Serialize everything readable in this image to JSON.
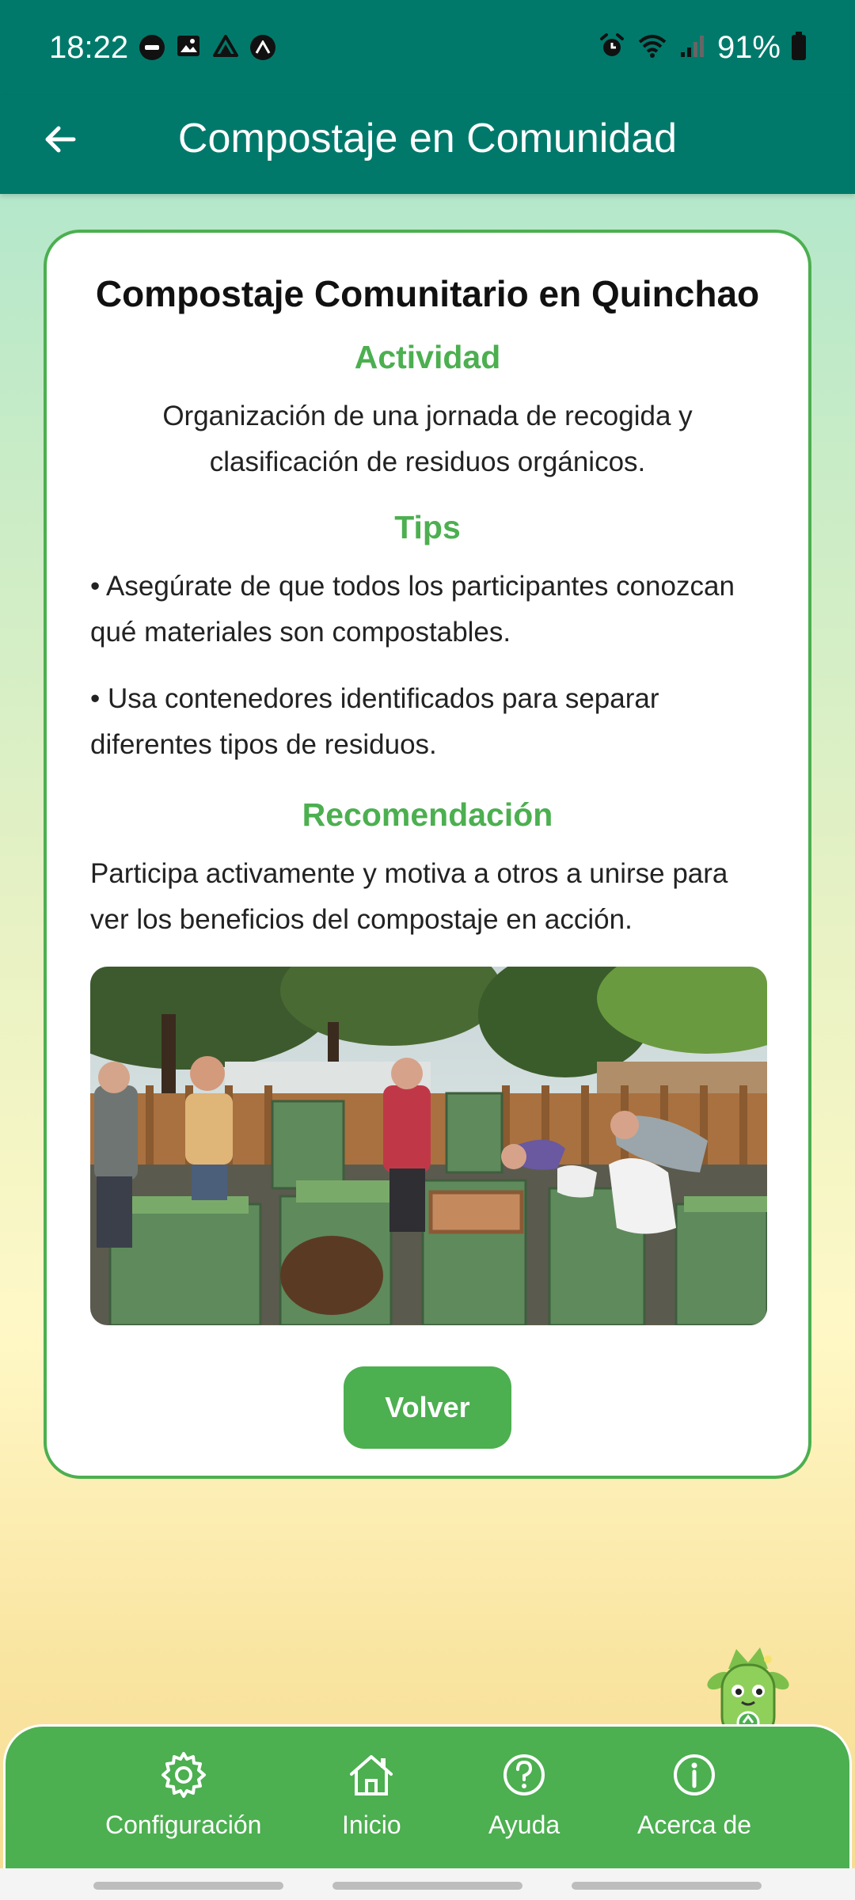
{
  "status_bar": {
    "time": "18:22",
    "battery": "91%"
  },
  "app_bar": {
    "title": "Compostaje en Comunidad",
    "back_icon": "arrow-left-icon"
  },
  "card": {
    "title": "Compostaje Comunitario en Quinchao",
    "activity_heading": "Actividad",
    "activity_text": "Organización de una jornada de recogida y clasificación de residuos orgánicos.",
    "tips_heading": "Tips",
    "tips": [
      "• Asegúrate de que todos los participantes conozcan qué materiales son compostables.",
      "• Usa contenedores identificados para separar diferentes tipos de residuos."
    ],
    "recommendation_heading": "Recomendación",
    "recommendation_text": "Participa activamente y motiva a otros a unirse para ver los beneficios del compostaje en acción.",
    "back_button": "Volver"
  },
  "bottom_nav": {
    "items": [
      {
        "label": "Configuración",
        "icon": "gear-icon"
      },
      {
        "label": "Inicio",
        "icon": "home-icon"
      },
      {
        "label": "Ayuda",
        "icon": "help-icon"
      },
      {
        "label": "Acerca de",
        "icon": "info-icon"
      }
    ]
  },
  "colors": {
    "primary": "#00796b",
    "accent": "#4caf50"
  }
}
